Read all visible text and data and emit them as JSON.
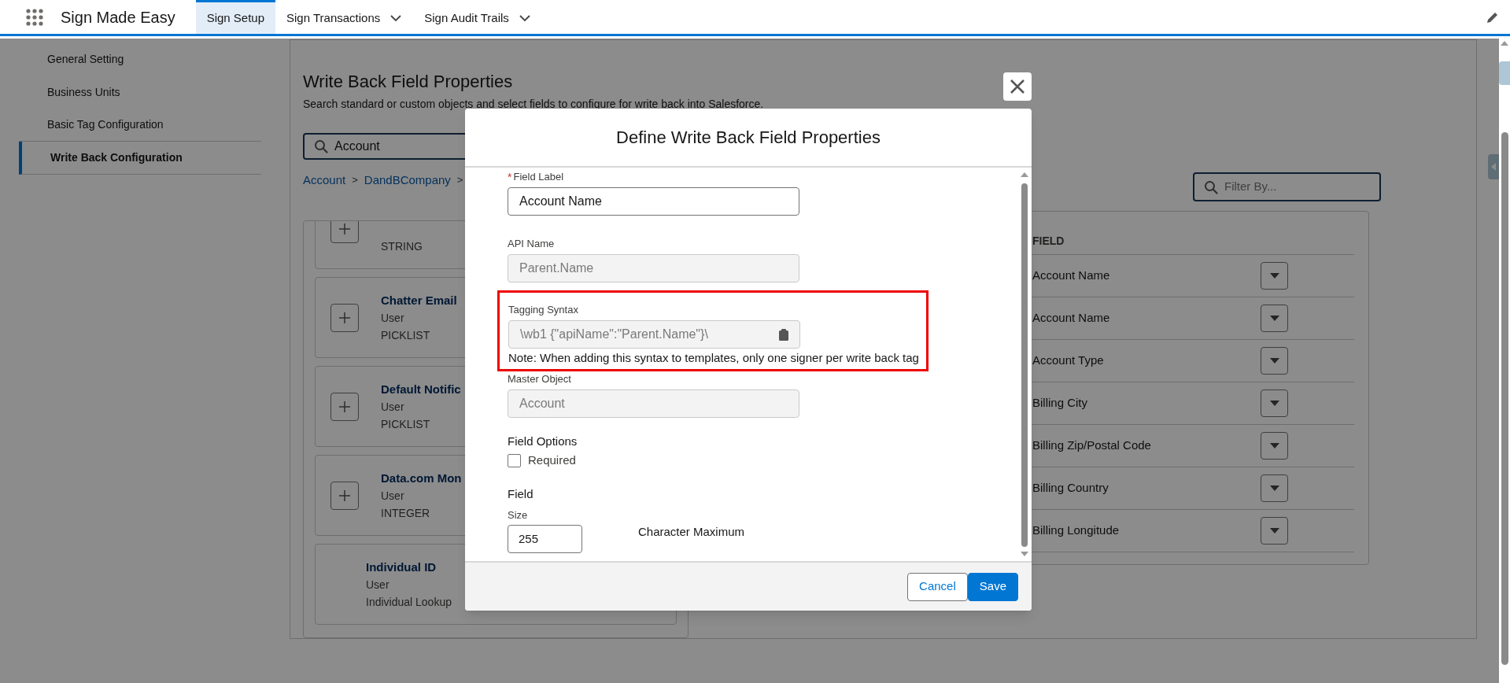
{
  "app": {
    "name": "Sign Made Easy"
  },
  "nav_tabs": [
    {
      "label": "Sign Setup",
      "selected": true,
      "has_menu": false
    },
    {
      "label": "Sign Transactions",
      "selected": false,
      "has_menu": true
    },
    {
      "label": "Sign Audit Trails",
      "selected": false,
      "has_menu": true
    }
  ],
  "sidebar": {
    "items": [
      {
        "label": "General Setting",
        "selected": false
      },
      {
        "label": "Business Units",
        "selected": false
      },
      {
        "label": "Basic Tag Configuration",
        "selected": false
      },
      {
        "label": "Write Back Configuration",
        "selected": true
      }
    ]
  },
  "page": {
    "title": "Write Back Field Properties",
    "subtitle": "Search standard or custom objects and select fields to configure for write back into Salesforce.",
    "search": {
      "value": "Account"
    },
    "breadcrumb": [
      "Account",
      "DandBCompany"
    ],
    "breadcrumb_separator": ">",
    "filter": {
      "placeholder": "Filter By..."
    }
  },
  "object_fields": [
    {
      "type": "STRING",
      "addable": true
    },
    {
      "title": "Chatter Email",
      "object": "User",
      "type": "PICKLIST",
      "addable": true
    },
    {
      "title": "Default Notific",
      "object": "User",
      "type": "PICKLIST",
      "addable": true
    },
    {
      "title": "Data.com Mon",
      "object": "User",
      "type": "INTEGER",
      "addable": true
    },
    {
      "title": "Individual ID",
      "object": "User",
      "type": "Individual Lookup",
      "addable": false
    }
  ],
  "field_table": {
    "header": "FIELD",
    "rows": [
      "Account Name",
      "Account Name",
      "Account Type",
      "Billing City",
      "Billing Zip/Postal Code",
      "Billing Country",
      "Billing Longitude"
    ]
  },
  "dialog": {
    "title": "Define Write Back Field Properties",
    "required_mark": "*",
    "fields": [
      {
        "kind": "text",
        "label": "Field Label",
        "required": true,
        "value": "Account Name"
      },
      {
        "kind": "readonly",
        "label": "API Name",
        "value": "Parent.Name"
      },
      {
        "kind": "copy",
        "label": "Tagging Syntax",
        "value": "\\wb1 {\"apiName\":\"Parent.Name\"}\\",
        "note": "Note: When adding this syntax to templates, only one signer per write back tag",
        "highlighted": true
      },
      {
        "kind": "readonly",
        "label": "Master Object",
        "value": "Account"
      }
    ],
    "options_label": "Field Options",
    "options": [
      {
        "label": "Required",
        "checked": false
      }
    ],
    "size": {
      "heading": "Field",
      "label": "Size",
      "value": "255",
      "unit": "Character Maximum"
    },
    "buttons": [
      {
        "label": "Cancel",
        "kind": "secondary"
      },
      {
        "label": "Save",
        "kind": "primary"
      }
    ]
  }
}
